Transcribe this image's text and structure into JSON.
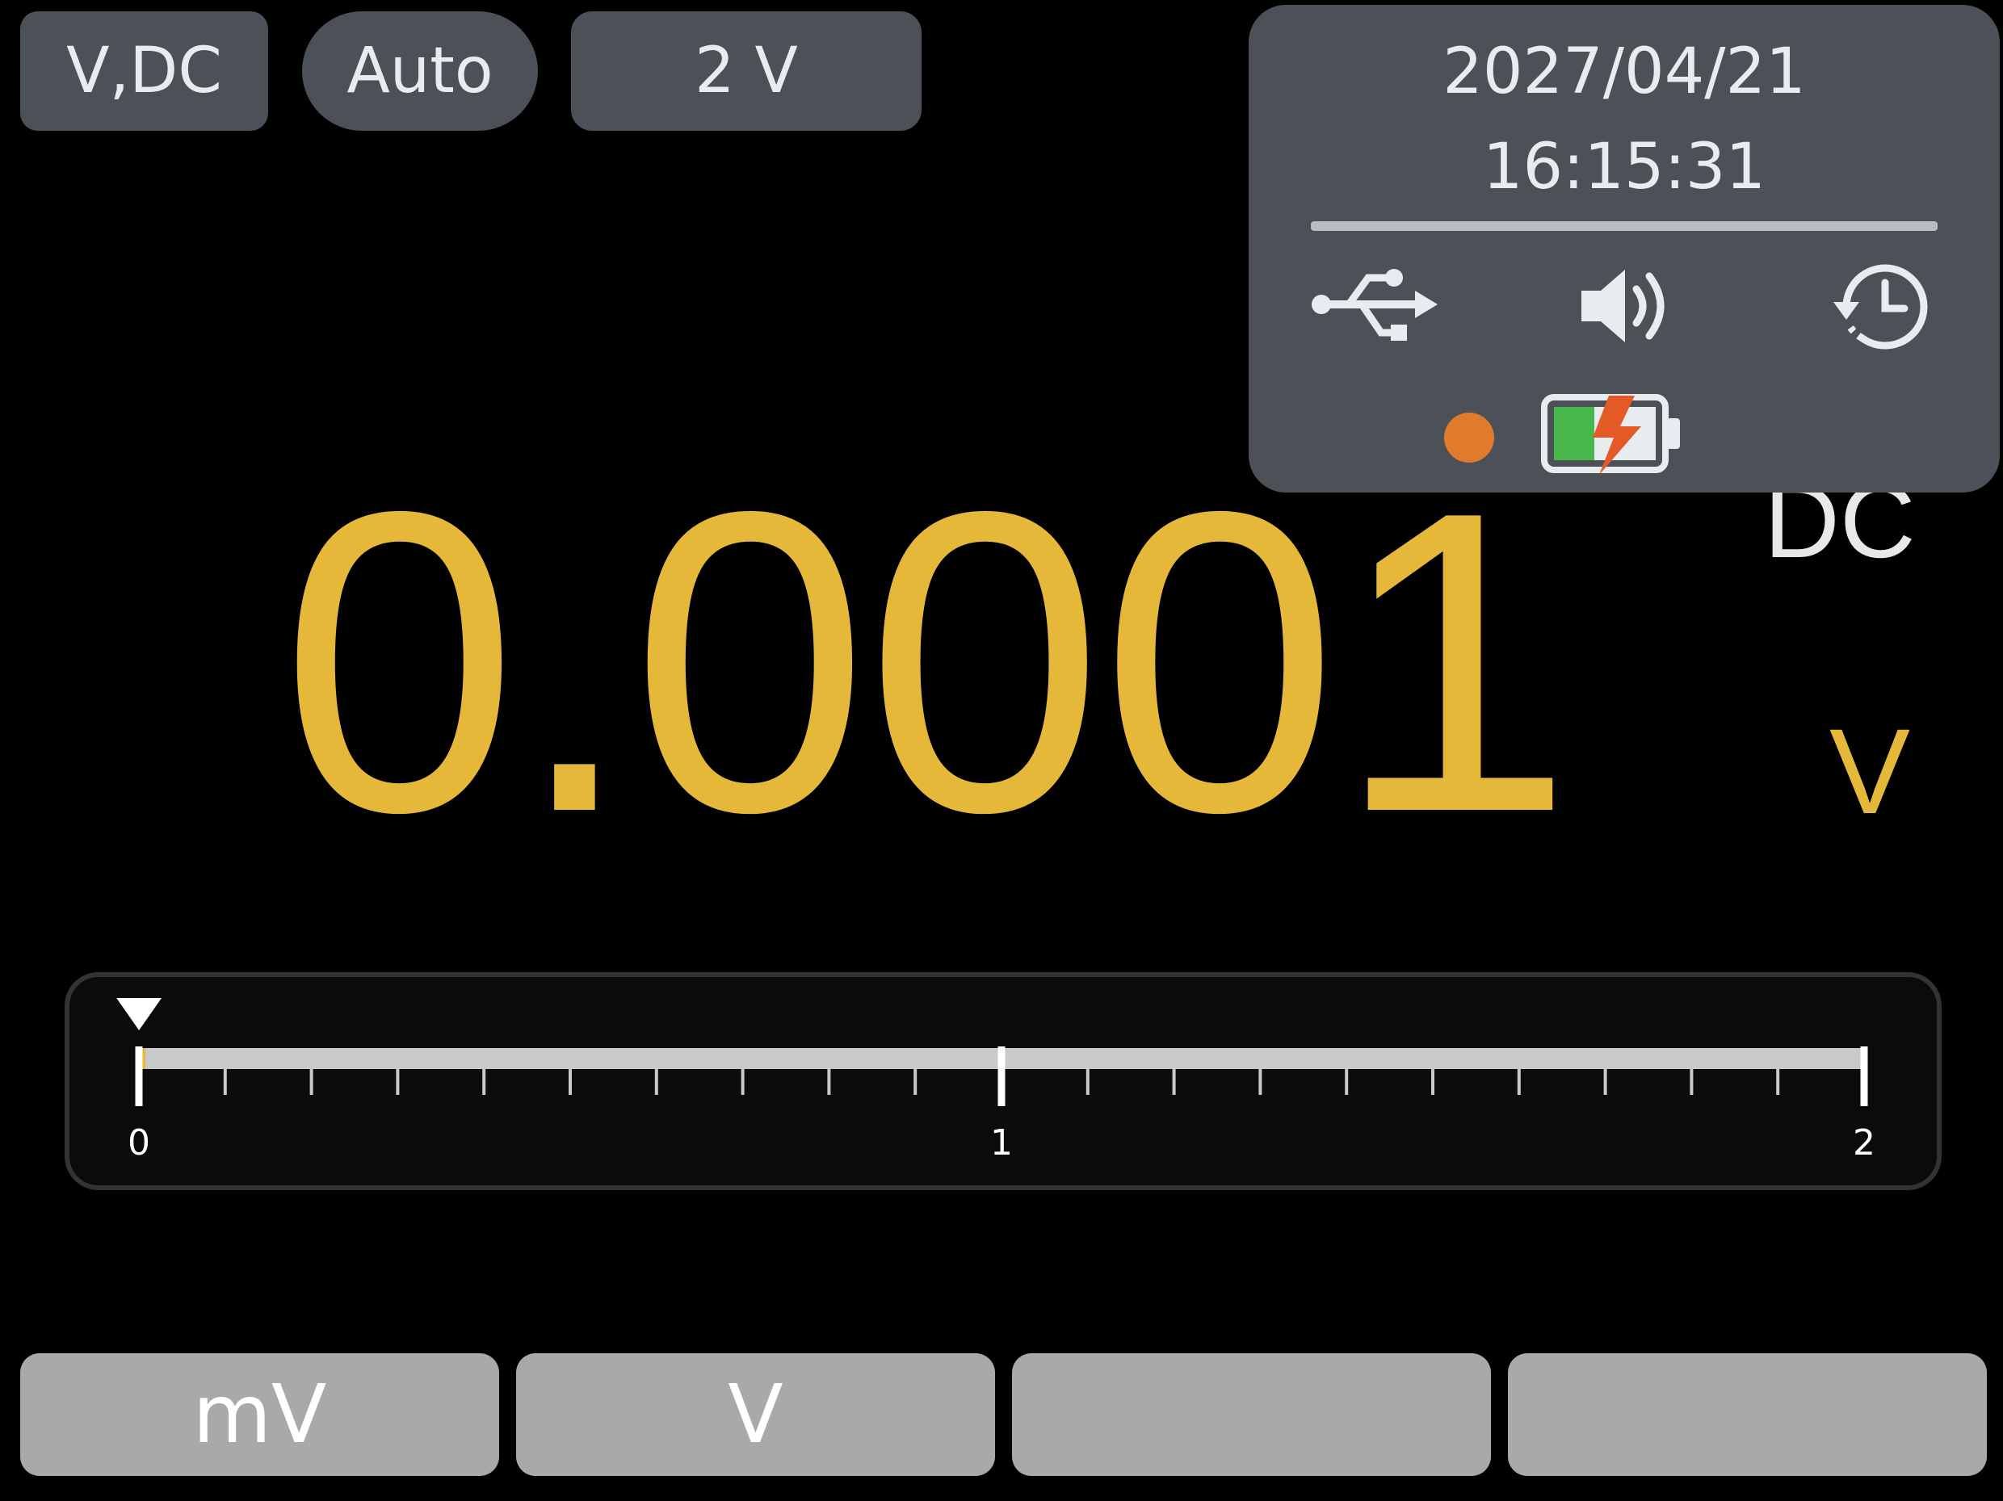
{
  "header": {
    "mode": "V,DC",
    "range_mode": "Auto",
    "range": "2 V"
  },
  "status": {
    "date": "2027/04/21",
    "time": "16:15:31",
    "icons": [
      "usb-icon",
      "speaker-icon",
      "history-icon",
      "battery-charging-icon"
    ],
    "indicator_color": "#e07b2c"
  },
  "reading": {
    "value": "0.0001",
    "unit": "V",
    "coupling": "DC"
  },
  "bargraph": {
    "min": 0,
    "max": 2,
    "labels": [
      "0",
      "1",
      "2"
    ],
    "value": 0.0001
  },
  "softkeys": [
    "mV",
    "V",
    "",
    ""
  ],
  "colors": {
    "reading": "#e6b83a",
    "pill_bg": "#4b5157",
    "softkey_bg": "#a9a9a9"
  }
}
